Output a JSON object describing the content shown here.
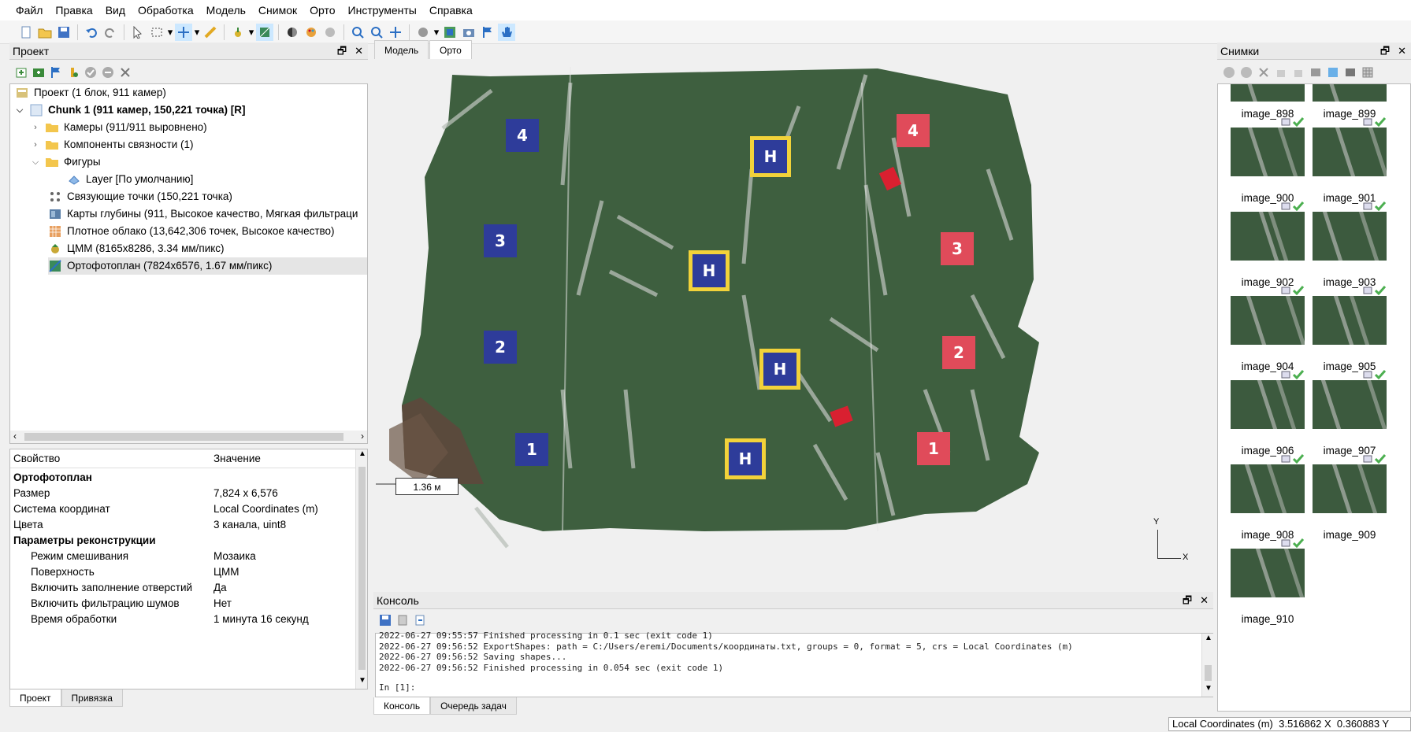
{
  "menu": [
    "Файл",
    "Правка",
    "Вид",
    "Обработка",
    "Модель",
    "Снимок",
    "Орто",
    "Инструменты",
    "Справка"
  ],
  "toolbar_icons": [
    "new-icon",
    "open-icon",
    "save-icon",
    "undo-icon",
    "redo-icon",
    "select-icon",
    "rect-select-icon",
    "navigate-icon",
    "ruler-icon",
    "draw-point-icon",
    "draw-polygon-icon",
    "shade-icon",
    "color-icon",
    "texture-icon",
    "zoom-in-icon",
    "zoom-out-icon",
    "move-icon",
    "sphere-icon",
    "ortho-view-icon",
    "camera-icon",
    "flag-icon",
    "hand-icon"
  ],
  "project": {
    "title": "Проект",
    "tree": {
      "root": "Проект (1 блок, 911 камер)",
      "chunk": "Chunk 1 (911 камер, 150,221 точка) [R]",
      "cameras": "Камеры (911/911 выровнено)",
      "components": "Компоненты связности (1)",
      "shapes": "Фигуры",
      "layer": "Layer [По умолчанию]",
      "tie_points": "Связующие точки (150,221 точка)",
      "depth_maps": "Карты глубины (911, Высокое качество, Мягкая фильтраци",
      "dense_cloud": "Плотное облако (13,642,306 точек, Высокое качество)",
      "dem": "ЦММ (8165x8286, 3.34 мм/пикс)",
      "ortho": "Ортофотоплан (7824x6576, 1.67 мм/пикс)"
    }
  },
  "properties": {
    "col_property": "Свойство",
    "col_value": "Значение",
    "section1": "Ортофотоплан",
    "rows1": [
      {
        "k": "Размер",
        "v": "7,824 x 6,576"
      },
      {
        "k": "Система координат",
        "v": "Local Coordinates (m)"
      },
      {
        "k": "Цвета",
        "v": "3 канала, uint8"
      }
    ],
    "section2": "Параметры реконструкции",
    "rows2": [
      {
        "k": "Режим смешивания",
        "v": "Мозаика"
      },
      {
        "k": "Поверхность",
        "v": "ЦММ"
      },
      {
        "k": "Включить заполнение отверстий",
        "v": "Да"
      },
      {
        "k": "Включить фильтрацию шумов",
        "v": "Нет"
      },
      {
        "k": "Время обработки",
        "v": "1 минута 16 секунд"
      }
    ]
  },
  "left_tabs": {
    "project": "Проект",
    "reference": "Привязка"
  },
  "view_tabs": {
    "model": "Модель",
    "ortho": "Орто"
  },
  "viewport": {
    "scale": "1.36 м",
    "axis_x": "X",
    "axis_y": "Y"
  },
  "console": {
    "title": "Консоль",
    "lines": [
      "2022-06-27 09:55:57 Finished processing in 0.1 sec (exit code 1)",
      "2022-06-27 09:56:52 ExportShapes: path = C:/Users/eremi/Documents/координаты.txt, groups = 0, format = 5, crs = Local Coordinates (m)",
      "2022-06-27 09:56:52 Saving shapes...",
      "2022-06-27 09:56:52 Finished processing in 0.054 sec (exit code 1)"
    ],
    "prompt": "In [1]:",
    "tabs": {
      "console": "Консоль",
      "queue": "Очередь задач"
    }
  },
  "photos": {
    "title": "Снимки",
    "items": [
      "image_898",
      "image_899",
      "image_900",
      "image_901",
      "image_902",
      "image_903",
      "image_904",
      "image_905",
      "image_906",
      "image_907",
      "image_908",
      "image_909",
      "image_910"
    ]
  },
  "status": {
    "coords": "Local Coordinates (m)  3.516862 X  0.360883 Y"
  },
  "colors": {
    "accent": "#cce8ff",
    "ground": "#3e5f3f",
    "pad_blue": "#2e3c9a",
    "pad_red": "#e04b5a"
  }
}
